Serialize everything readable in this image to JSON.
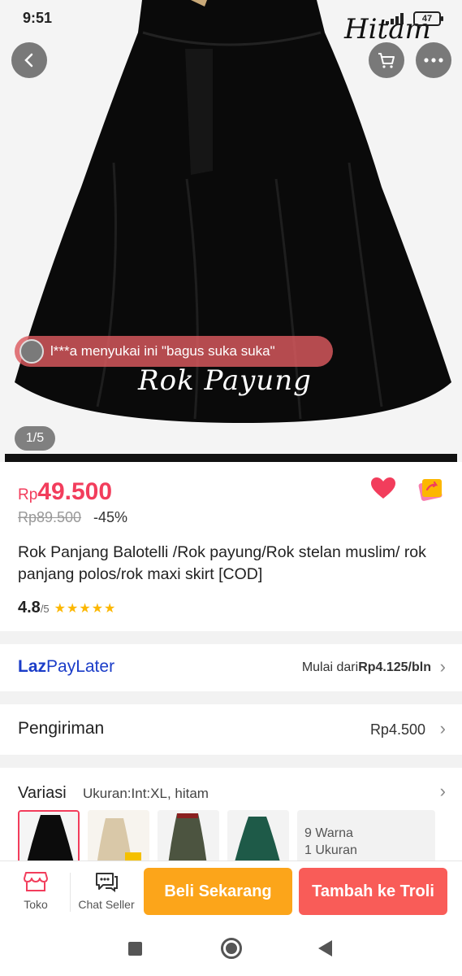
{
  "status_bar": {
    "time": "9:51",
    "battery": "47"
  },
  "hero": {
    "brand_logo": "Hitam",
    "watermark": "Rok Payung",
    "liked_text": "l***a menyukai ini \"bagus suka suka\"",
    "counter": "1/5"
  },
  "product": {
    "currency": "Rp",
    "price": "49.500",
    "old_price": "Rp89.500",
    "discount": "-45%",
    "title": "Rok Panjang Balotelli /Rok payung/Rok stelan muslim/ rok panjang polos/rok maxi skirt  [COD]",
    "rating": "4.8",
    "rating_max": "/5",
    "stars": "★★★★★"
  },
  "paylater": {
    "logo_laz": "Laz",
    "logo_rest": "PayLater",
    "info_prefix": "Mulai dari",
    "info_amount": "Rp4.125/bln"
  },
  "shipping": {
    "label": "Pengiriman",
    "amount": "Rp4.500"
  },
  "variation": {
    "label": "Variasi",
    "selected": "Ukuran:Int:XL, hitam",
    "colors_count": "9 Warna",
    "sizes_count": "1 Ukuran"
  },
  "actions": {
    "toko": "Toko",
    "chat": "Chat Seller",
    "buy": "Beli Sekarang",
    "add_cart": "Tambah ke Troli"
  },
  "colors": {
    "accent": "#f23d5c",
    "buy_button": "#fca51a",
    "cart_button": "#f95c58",
    "paylater_blue": "#1a3cc8"
  }
}
